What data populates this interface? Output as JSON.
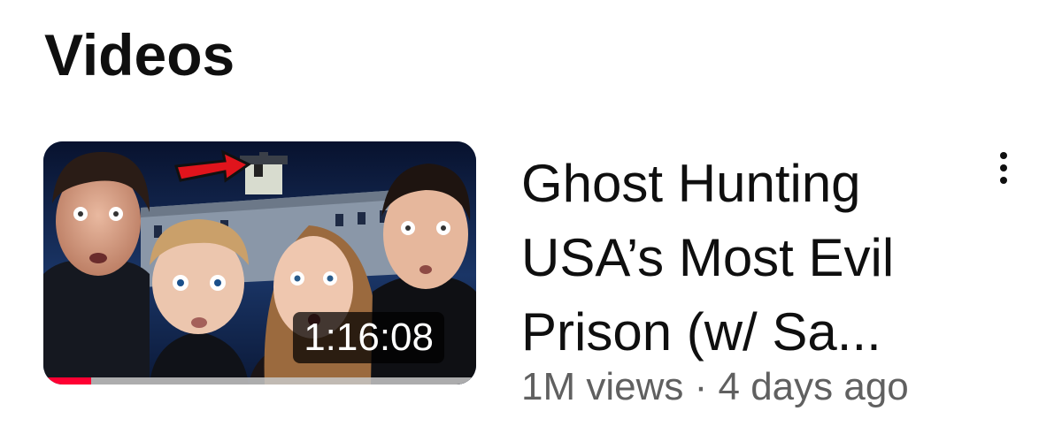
{
  "section": {
    "title": "Videos"
  },
  "video": {
    "title_lines": [
      "Ghost Hunting",
      "USA’s Most Evil",
      "Prison (w/ Sa..."
    ],
    "views": "1M views",
    "separator": "·",
    "age": "4 days ago",
    "duration": "1:16:08",
    "watch_progress_fraction": 0.11,
    "thumbnail_icon": "haunted-prison-thumbnail",
    "more_icon": "more-vert-icon"
  },
  "colors": {
    "progress": "#ff0033",
    "title_text": "#0f0f0f",
    "secondary_text": "#606060"
  }
}
